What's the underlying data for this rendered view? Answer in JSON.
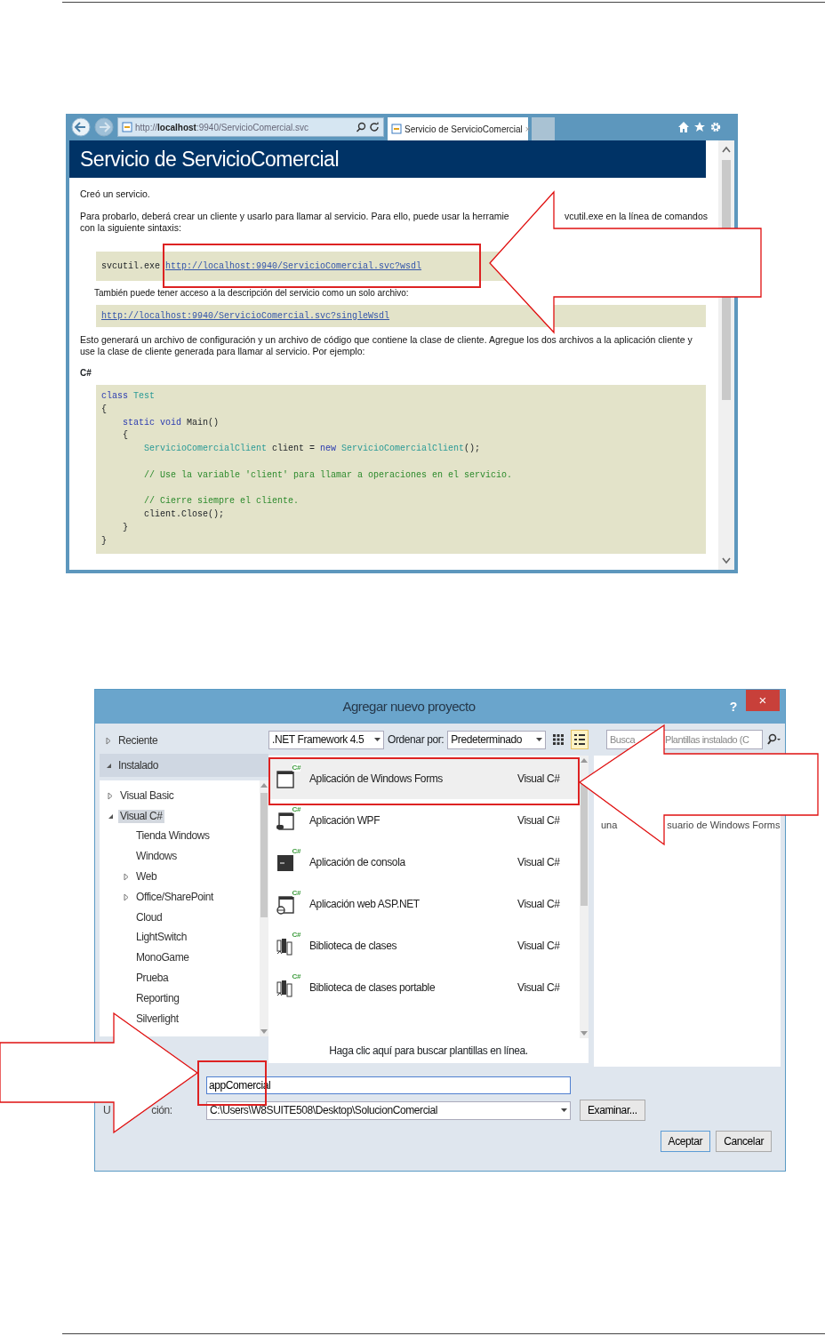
{
  "browser": {
    "address_parts": [
      "http://",
      "localhost",
      ":9940/ServicioComercial.svc"
    ],
    "tab": {
      "title": "Servicio de ServicioComercial",
      "close": "×"
    },
    "page_title": "Servicio de ServicioComercial",
    "content": [
      {
        "kind": "text",
        "text": "Creó un servicio."
      },
      {
        "kind": "split",
        "parts": [
          "Para probarlo, deberá crear un cliente y usarlo para llamar al servicio. Para ello, puede usar la herramie",
          "vcutil.exe en la línea de comandos"
        ],
        "text": "con la siguiente sintaxis:"
      },
      {
        "kind": "command",
        "prefix": "svcutil.exe",
        "link": "http://localhost:9940/ServicioComercial.svc?wsdl"
      },
      {
        "kind": "note",
        "text": "También puede tener acceso a la descripción del servicio como un solo archivo:"
      },
      {
        "kind": "command",
        "link": "http://localhost:9940/ServicioComercial.svc?singleWsdl"
      },
      {
        "kind": "text",
        "text": "Esto generará un archivo de configuración y un archivo de código que contiene la clase de cliente. Agregue los dos archivos a la aplicación cliente y use la clase de cliente generada para llamar al servicio. Por ejemplo:"
      },
      {
        "kind": "heading",
        "text": "C#"
      },
      {
        "kind": "code",
        "lines": [
          {
            "segments": [
              {
                "t": "class",
                "kind": "keyword"
              },
              {
                "t": " Test",
                "kind": "type"
              }
            ]
          },
          {
            "segments": [
              {
                "t": "{"
              }
            ]
          },
          {
            "segments": [
              {
                "t": "    static",
                "kind": "keyword"
              },
              {
                "t": " void",
                "kind": "keyword"
              },
              {
                "t": " Main()"
              }
            ]
          },
          {
            "segments": [
              {
                "t": "    {"
              }
            ]
          },
          {
            "segments": [
              {
                "t": "        ServicioComercialClient",
                "kind": "type"
              },
              {
                "t": " client = "
              },
              {
                "t": "new",
                "kind": "keyword"
              },
              {
                "t": " ServicioComercialClient",
                "kind": "type"
              },
              {
                "t": "();"
              }
            ]
          },
          {
            "blank_before": true,
            "segments": [
              {
                "t": "        // Use la variable 'client' para llamar a operaciones en el servicio.",
                "kind": "comment"
              }
            ]
          },
          {
            "blank_before": true,
            "segments": [
              {
                "t": "        // Cierre siempre el cliente.",
                "kind": "comment"
              }
            ]
          },
          {
            "segments": [
              {
                "t": "        client.Close();"
              }
            ]
          },
          {
            "segments": [
              {
                "t": "    }"
              }
            ]
          },
          {
            "segments": [
              {
                "t": "}"
              }
            ]
          }
        ]
      }
    ]
  },
  "dialog": {
    "title": "Agregar nuevo proyecto",
    "help": "?",
    "close": "×",
    "nav": [
      {
        "label": "Reciente",
        "expanded": false,
        "selected": false
      },
      {
        "label": "Instalado",
        "expanded": true,
        "selected": true
      }
    ],
    "tree": [
      {
        "label": "Visual Basic",
        "expanded": false,
        "selected": false
      },
      {
        "label": "Visual C#",
        "expanded": true,
        "selected": true,
        "children": [
          {
            "label": "Tienda Windows",
            "selected": false
          },
          {
            "label": "Windows",
            "selected": false
          },
          {
            "label": "Web",
            "expanded": false,
            "selected": false
          },
          {
            "label": "Office/SharePoint",
            "expanded": false,
            "selected": false
          },
          {
            "label": "Cloud",
            "selected": false
          },
          {
            "label": "LightSwitch",
            "selected": false
          },
          {
            "label": "MonoGame",
            "selected": false
          },
          {
            "label": "Prueba",
            "selected": false
          },
          {
            "label": "Reporting",
            "selected": false
          },
          {
            "label": "Silverlight",
            "selected": false
          }
        ]
      }
    ],
    "framework": ".NET Framework 4.5",
    "sort_label": "Ordenar por:",
    "sort": "Predeterminado",
    "views": [
      {
        "kind": "grid",
        "selected": false
      },
      {
        "kind": "list",
        "selected": true
      }
    ],
    "search_parts": [
      "Busca",
      "Plantillas instalado (C"
    ],
    "templates": [
      {
        "name": "Aplicación de Windows Forms",
        "language": "Visual C#",
        "kind": "window",
        "badge": "C#",
        "selected": true
      },
      {
        "name": "Aplicación WPF",
        "language": "Visual C#",
        "kind": "wpf",
        "badge": "C#",
        "selected": false
      },
      {
        "name": "Aplicación de consola",
        "language": "Visual C#",
        "kind": "console",
        "badge": "C#",
        "selected": false
      },
      {
        "name": "Aplicación web ASP.NET",
        "language": "Visual C#",
        "kind": "web",
        "badge": "C#",
        "selected": false
      },
      {
        "name": "Biblioteca de clases",
        "language": "Visual C#",
        "kind": "library",
        "badge": "C#",
        "selected": false
      },
      {
        "name": "Biblioteca de clases portable",
        "language": "Visual C#",
        "kind": "library",
        "badge": "C#",
        "selected": false
      }
    ],
    "online_link": "Haga clic aquí para buscar plantillas en línea.",
    "description_parts": [
      "una",
      "suario de Windows Forms"
    ],
    "name_value": "appComercial",
    "location_label_parts": [
      "U",
      "ción:"
    ],
    "location": "C:\\Users\\W8SUITE508\\Desktop\\SolucionComercial",
    "browse": "Examinar...",
    "buttons": [
      "Aceptar",
      "Cancelar"
    ]
  }
}
